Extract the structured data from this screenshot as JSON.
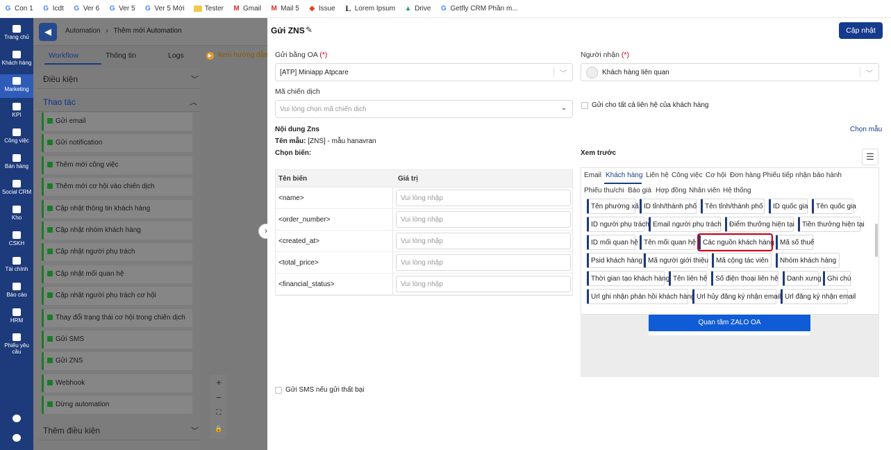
{
  "bookmarks": [
    {
      "icon": "g",
      "label": "Con 1"
    },
    {
      "icon": "g",
      "label": "Icdt"
    },
    {
      "icon": "g",
      "label": "Ver 6"
    },
    {
      "icon": "g",
      "label": "Ver 5"
    },
    {
      "icon": "g",
      "label": "Ver 5 Mới"
    },
    {
      "icon": "folder",
      "label": "Tester"
    },
    {
      "icon": "gmail",
      "label": "Gmail"
    },
    {
      "icon": "gmail",
      "label": "Mail 5"
    },
    {
      "icon": "gitlab",
      "label": "Issue"
    },
    {
      "icon": "lorem",
      "label": "Lorem Ipsum"
    },
    {
      "icon": "drive",
      "label": "Drive"
    },
    {
      "icon": "g",
      "label": "Getfly CRM Phần m..."
    }
  ],
  "rail": [
    {
      "label": "Trang chủ",
      "icon": "home-icon"
    },
    {
      "label": "Khách hàng",
      "icon": "users-icon"
    },
    {
      "label": "Marketing",
      "icon": "megaphone-icon",
      "active": true
    },
    {
      "label": "KPI",
      "icon": "chart-icon"
    },
    {
      "label": "Công việc",
      "icon": "briefcase-icon"
    },
    {
      "label": "Bán hàng",
      "icon": "cart-icon"
    },
    {
      "label": "Social CRM",
      "icon": "share-icon"
    },
    {
      "label": "Kho",
      "icon": "box-icon"
    },
    {
      "label": "CSKH",
      "icon": "phone-icon"
    },
    {
      "label": "Tài chính",
      "icon": "wallet-icon"
    },
    {
      "label": "Báo cáo",
      "icon": "report-icon"
    },
    {
      "label": "HRM",
      "icon": "hrm-icon"
    },
    {
      "label": "Phiếu yêu cầu",
      "icon": "ticket-icon"
    },
    {
      "label": "",
      "icon": "globe-icon"
    },
    {
      "label": "",
      "icon": "gear-icon"
    }
  ],
  "breadcrumb": {
    "parent": "Automation",
    "sep": "›",
    "current": "Thêm mới Automation"
  },
  "mid_tabs": [
    "Workflow",
    "Thông tin",
    "Logs"
  ],
  "guide": "Xem hướng dẫn",
  "sections": {
    "conditions": "Điều kiện",
    "actions": "Thao tác",
    "add_condition": "Thêm điều kiện"
  },
  "actions": [
    "Gửi email",
    "Gửi notification",
    "Thêm mới công việc",
    "Thêm mới cơ hội vào chiến dịch",
    "Cập nhật thông tin khách hàng",
    "Cập nhật nhóm khách hàng",
    "Cập nhật người phụ trách",
    "Cập nhật mối quan hệ",
    "Cập nhật người phụ trách cơ hội",
    "Thay đổi trạng thái cơ hội trong chiến dịch",
    "Gửi SMS",
    "Gửi ZNS",
    "Webhook",
    "Dừng automation"
  ],
  "zoom_controls": [
    "+",
    "−",
    "⛶",
    "🔒"
  ],
  "form": {
    "title": "Gửi ZNS",
    "save": "Cập nhật",
    "oa_label": "Gửi bằng OA",
    "req": "(*)",
    "oa_value": "[ATP] Miniapp Atpcare",
    "recipient_label": "Người nhận",
    "recipient_value": "Khách hàng liên quan",
    "campaign_label": "Mã chiến dịch",
    "campaign_placeholder": "Vui lòng chọn mã chiến dịch",
    "send_all": "Gửi cho tất cả liên hệ của khách hàng",
    "content_label": "Nội dung Zns",
    "template_label": "Tên mẫu:",
    "template_value": " [ZNS] - mẫu hanavran",
    "choose_template": "Chọn mẫu",
    "choose_var": "Chọn biến:",
    "preview_label": "Xem trước",
    "fail_sms": "Gửi SMS nếu gửi thất bại"
  },
  "var_table": {
    "headers": [
      "Tên biến",
      "Giá trị"
    ],
    "placeholder": "Vui lòng nhập",
    "rows": [
      "<name>",
      "<order_number>",
      "<created_at>",
      "<total_price>",
      "<financial_status>"
    ]
  },
  "picker_tabs_row1": [
    "Email",
    "Khách hàng",
    "Liên hệ",
    "Công việc",
    "Cơ hội",
    "Đơn hàng",
    "Phiếu tiếp nhận bảo hành"
  ],
  "picker_tabs_row2": [
    "Phiếu thu/chi",
    "Báo giá",
    "Hợp đồng",
    "Nhân viên",
    "Hệ thống"
  ],
  "chips": [
    [
      "Tên phường xã",
      "ID tỉnh/thành phố",
      "Tên tỉnh/thành phố",
      "ID quốc gia",
      "Tên quốc gia"
    ],
    [
      "ID người phụ trách",
      "Email người phụ trách",
      "Điểm thưởng hiện tại",
      "Tiền thưởng hiện tại"
    ],
    [
      "ID mối quan hệ",
      "Tên mối quan hệ",
      "Các nguồn khách hàng",
      "Mã số thuế"
    ],
    [
      "Psid khách hàng",
      "Mã người giới thiệu",
      "Mã cộng tác viên",
      "Nhóm khách hàng"
    ],
    [
      "Thời gian tạo khách hàng",
      "Tên liên hệ",
      "Số điện thoại liên hệ",
      "Danh xưng",
      "Ghi chú"
    ],
    [
      "Url ghi nhận phản hồi khách hàng",
      "Url hủy đăng ký nhận email",
      "Url đăng ký nhận email"
    ]
  ],
  "highlighted_chip": "Các nguồn khách hàng",
  "zalo_button": "Quan tâm ZALO OA"
}
